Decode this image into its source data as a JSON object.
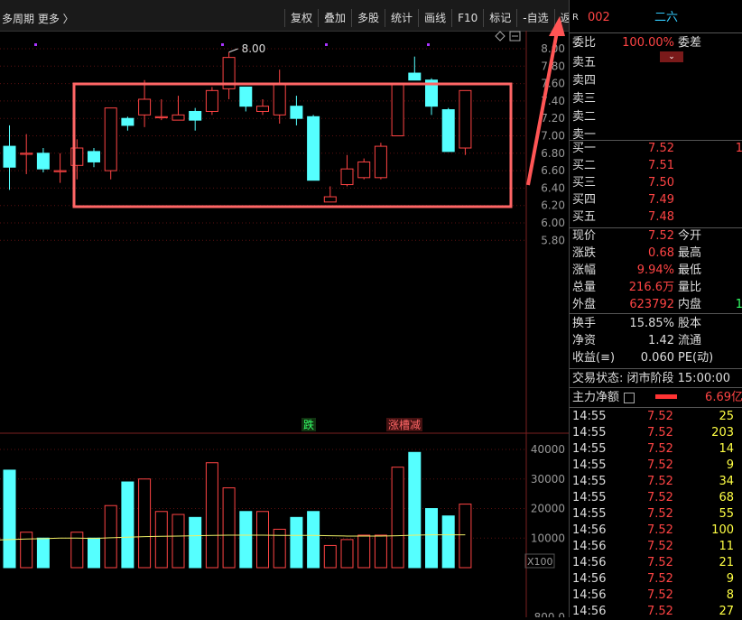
{
  "topbar": {
    "period_label": "多周期  更多 〉",
    "tools": [
      "复权",
      "叠加",
      "多股",
      "统计",
      "画线",
      "F10",
      "标记",
      "-自选",
      "返回"
    ]
  },
  "chart_data": {
    "type": "candlestick",
    "y_ticks": [
      "8.00",
      "7.80",
      "7.60",
      "7.40",
      "7.20",
      "7.00",
      "6.80",
      "6.60",
      "6.40",
      "6.20",
      "6.00",
      "5.80"
    ],
    "max_label": "8.00",
    "annotations": [
      "跌",
      "涨槽减"
    ],
    "volume_ticks": [
      "40000",
      "30000",
      "20000",
      "10000"
    ],
    "volume_unit": "X100",
    "bottom_tick": "800.0",
    "candles": [
      {
        "o": 6.88,
        "c": 6.64,
        "h": 7.12,
        "l": 6.38
      },
      {
        "o": 6.8,
        "c": 6.8,
        "h": 7.02,
        "l": 6.56
      },
      {
        "o": 6.8,
        "c": 6.62,
        "h": 6.86,
        "l": 6.58
      },
      {
        "o": 6.6,
        "c": 6.6,
        "h": 6.8,
        "l": 6.46
      },
      {
        "o": 6.66,
        "c": 6.86,
        "h": 6.96,
        "l": 6.5
      },
      {
        "o": 6.82,
        "c": 6.7,
        "h": 6.86,
        "l": 6.64
      },
      {
        "o": 6.6,
        "c": 7.32,
        "h": 7.32,
        "l": 6.5
      },
      {
        "o": 7.2,
        "c": 7.12,
        "h": 7.22,
        "l": 7.06
      },
      {
        "o": 7.24,
        "c": 7.42,
        "h": 7.64,
        "l": 7.1
      },
      {
        "o": 7.22,
        "c": 7.22,
        "h": 7.42,
        "l": 7.18
      },
      {
        "o": 7.18,
        "c": 7.24,
        "h": 7.46,
        "l": 7.18
      },
      {
        "o": 7.28,
        "c": 7.18,
        "h": 7.32,
        "l": 7.06
      },
      {
        "o": 7.28,
        "c": 7.52,
        "h": 7.56,
        "l": 7.24
      },
      {
        "o": 7.54,
        "c": 7.9,
        "h": 7.96,
        "l": 7.42
      },
      {
        "o": 7.56,
        "c": 7.34,
        "h": 7.56,
        "l": 7.28
      },
      {
        "o": 7.28,
        "c": 7.34,
        "h": 7.42,
        "l": 7.24
      },
      {
        "o": 7.24,
        "c": 7.6,
        "h": 7.76,
        "l": 7.14
      },
      {
        "o": 7.34,
        "c": 7.2,
        "h": 7.46,
        "l": 7.12
      },
      {
        "o": 7.22,
        "c": 6.49,
        "h": 7.24,
        "l": 6.49
      },
      {
        "o": 6.24,
        "c": 6.3,
        "h": 6.42,
        "l": 6.24
      },
      {
        "o": 6.44,
        "c": 6.62,
        "h": 6.78,
        "l": 6.42
      },
      {
        "o": 6.52,
        "c": 6.7,
        "h": 6.74,
        "l": 6.5
      },
      {
        "o": 6.52,
        "c": 6.88,
        "h": 6.92,
        "l": 6.5
      },
      {
        "o": 7.0,
        "c": 7.6,
        "h": 7.6,
        "l": 7.0
      },
      {
        "o": 7.72,
        "c": 7.64,
        "h": 7.91,
        "l": 7.64
      },
      {
        "o": 7.64,
        "c": 7.34,
        "h": 7.66,
        "l": 7.24
      },
      {
        "o": 7.3,
        "c": 6.82,
        "h": 7.32,
        "l": 6.82
      },
      {
        "o": 6.86,
        "c": 7.52,
        "h": 7.52,
        "l": 6.78
      }
    ],
    "volume_values": [
      33000,
      12000,
      10000,
      0,
      12000,
      10000,
      21000,
      29000,
      30000,
      19000,
      18000,
      17000,
      35500,
      27000,
      19000,
      19000,
      13000,
      17000,
      19000,
      7500,
      9500,
      11000,
      11000,
      34000,
      39000,
      20000,
      17500,
      21500
    ],
    "ma_line": [
      9500,
      9700,
      9800,
      10000,
      10000,
      9900,
      10100,
      10300,
      10500,
      10600,
      10700,
      10800,
      10900,
      11000,
      11000,
      11000,
      10900,
      10900,
      10900,
      10800,
      10700,
      10700,
      10700,
      10800,
      11000,
      11100,
      11100,
      11100
    ]
  },
  "quote": {
    "code": "002",
    "name": "二六",
    "weibi_label": "委比",
    "weibi_value": "100.00%",
    "weicha_label": "委差",
    "asks": [
      {
        "label": "卖五"
      },
      {
        "label": "卖四"
      },
      {
        "label": "卖三"
      },
      {
        "label": "卖二"
      },
      {
        "label": "卖一"
      }
    ],
    "bids": [
      {
        "label": "买一",
        "price": "7.52",
        "vol": "1"
      },
      {
        "label": "买二",
        "price": "7.51"
      },
      {
        "label": "买三",
        "price": "7.50"
      },
      {
        "label": "买四",
        "price": "7.49"
      },
      {
        "label": "买五",
        "price": "7.48"
      }
    ],
    "stats": [
      {
        "l": "现价",
        "v": "7.52",
        "l2": "今开"
      },
      {
        "l": "涨跌",
        "v": "0.68",
        "l2": "最高"
      },
      {
        "l": "涨幅",
        "v": "9.94%",
        "l2": "最低"
      },
      {
        "l": "总量",
        "v": "216.6万",
        "l2": "量比"
      },
      {
        "l": "外盘",
        "v": "623792",
        "l2": "内盘",
        "r2": "1"
      }
    ],
    "stats2": [
      {
        "l": "换手",
        "v": "15.85%",
        "l2": "股本"
      },
      {
        "l": "净资",
        "v": "1.42",
        "l2": "流通"
      },
      {
        "l": "收益(≡)",
        "v": "0.060",
        "l2": "PE(动)"
      }
    ],
    "status_label": "交易状态: 闭市阶段 15:00:00",
    "main_net_label": "主力净额",
    "main_net_value": "6.69亿"
  },
  "ticks": [
    {
      "t": "14:55",
      "p": "7.52",
      "q": "25"
    },
    {
      "t": "14:55",
      "p": "7.52",
      "q": "203"
    },
    {
      "t": "14:55",
      "p": "7.52",
      "q": "14"
    },
    {
      "t": "14:55",
      "p": "7.52",
      "q": "9"
    },
    {
      "t": "14:55",
      "p": "7.52",
      "q": "34"
    },
    {
      "t": "14:55",
      "p": "7.52",
      "q": "68"
    },
    {
      "t": "14:55",
      "p": "7.52",
      "q": "55"
    },
    {
      "t": "14:56",
      "p": "7.52",
      "q": "100"
    },
    {
      "t": "14:56",
      "p": "7.52",
      "q": "11"
    },
    {
      "t": "14:56",
      "p": "7.52",
      "q": "21"
    },
    {
      "t": "14:56",
      "p": "7.52",
      "q": "9"
    },
    {
      "t": "14:56",
      "p": "7.52",
      "q": "8"
    },
    {
      "t": "14:56",
      "p": "7.52",
      "q": "27"
    }
  ],
  "colors": {
    "up": "#ff4444",
    "down": "#55ffff",
    "box": "#ff6666",
    "arrow": "#ff5555"
  }
}
